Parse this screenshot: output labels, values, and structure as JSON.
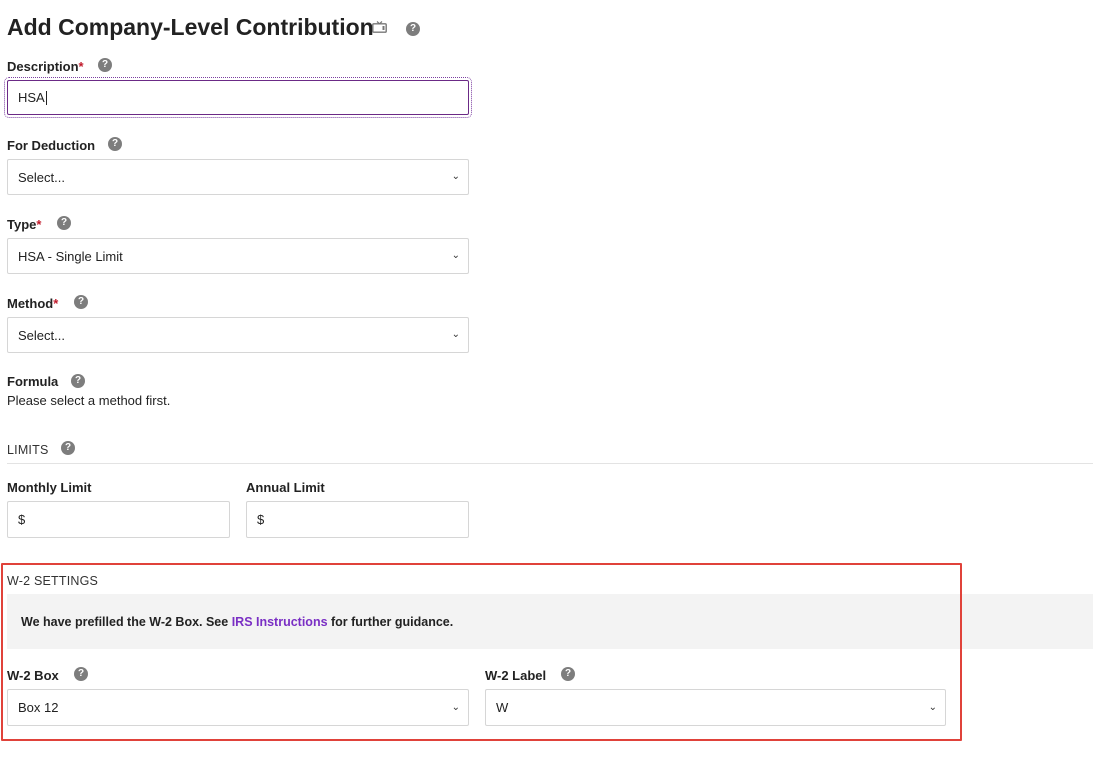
{
  "page": {
    "title": "Add Company-Level Contribution"
  },
  "icons": {
    "video": "tv-icon",
    "help": "?"
  },
  "form": {
    "description": {
      "label": "Description",
      "required_mark": "*",
      "value": "HSA"
    },
    "for_deduction": {
      "label": "For Deduction",
      "selected": "Select..."
    },
    "type": {
      "label": "Type",
      "required_mark": "*",
      "selected": "HSA - Single Limit"
    },
    "method": {
      "label": "Method",
      "required_mark": "*",
      "selected": "Select..."
    },
    "formula": {
      "label": "Formula",
      "helper": "Please select a method first."
    }
  },
  "limits": {
    "heading": "LIMITS",
    "monthly": {
      "label": "Monthly Limit",
      "prefix": "$"
    },
    "annual": {
      "label": "Annual Limit",
      "prefix": "$"
    }
  },
  "w2": {
    "heading": "W-2 SETTINGS",
    "banner_before": "We have prefilled the W-2 Box. See ",
    "banner_link": "IRS Instructions",
    "banner_after": " for further guidance.",
    "box": {
      "label": "W-2 Box",
      "selected": "Box 12"
    },
    "w2_label": {
      "label": "W-2 Label",
      "selected": "W"
    }
  },
  "colors": {
    "accent_purple": "#7a2fc4",
    "required_red": "#c0192a",
    "highlight_red": "#e0423a"
  }
}
